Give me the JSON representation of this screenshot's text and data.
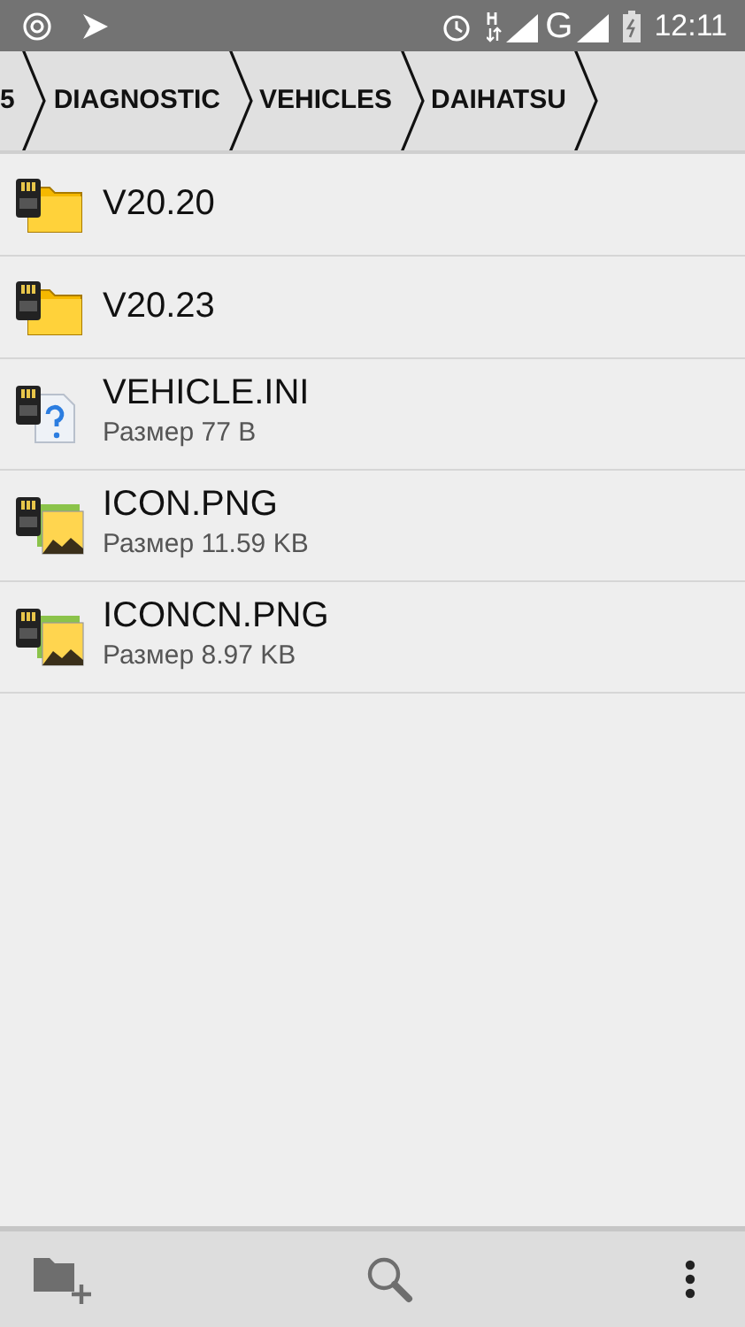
{
  "status_bar": {
    "time": "12:11",
    "network": "G"
  },
  "breadcrumbs": [
    {
      "label": "5"
    },
    {
      "label": "DIAGNOSTIC"
    },
    {
      "label": "VEHICLES"
    },
    {
      "label": "DAIHATSU"
    }
  ],
  "files": [
    {
      "kind": "folder",
      "name": "V20.20"
    },
    {
      "kind": "folder",
      "name": "V20.23"
    },
    {
      "kind": "unknown",
      "name": "VEHICLE.INI",
      "size": "Размер 77 B"
    },
    {
      "kind": "image",
      "name": "ICON.PNG",
      "size": "Размер 11.59 KB"
    },
    {
      "kind": "image",
      "name": "ICONCN.PNG",
      "size": "Размер 8.97 KB"
    }
  ]
}
